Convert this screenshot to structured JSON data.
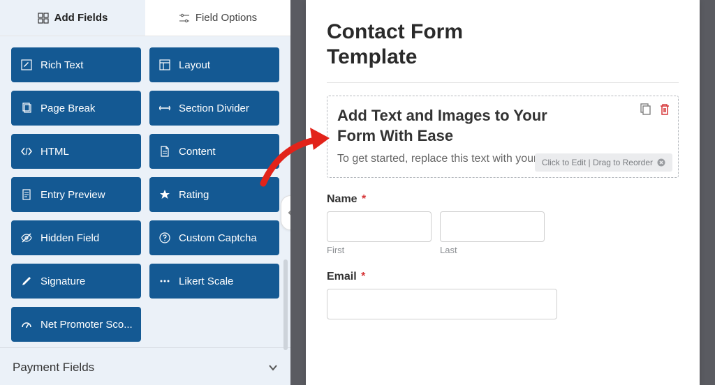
{
  "tabs": {
    "add_fields": "Add Fields",
    "field_options": "Field Options"
  },
  "fields": {
    "rich_text": "Rich Text",
    "layout": "Layout",
    "page_break": "Page Break",
    "section_divider": "Section Divider",
    "html": "HTML",
    "content": "Content",
    "entry_preview": "Entry Preview",
    "rating": "Rating",
    "hidden_field": "Hidden Field",
    "custom_captcha": "Custom Captcha",
    "signature": "Signature",
    "likert_scale": "Likert Scale",
    "net_promoter": "Net Promoter Sco..."
  },
  "accordion": {
    "payment": "Payment Fields"
  },
  "form": {
    "title": "Contact Form Template",
    "content_title": "Add Text and Images to Your Form With Ease",
    "content_body": "To get started, replace this text with your own.",
    "hint": "Click to Edit | Drag to Reorder",
    "name_label": "Name",
    "first": "First",
    "last": "Last",
    "email_label": "Email",
    "required": "*"
  }
}
